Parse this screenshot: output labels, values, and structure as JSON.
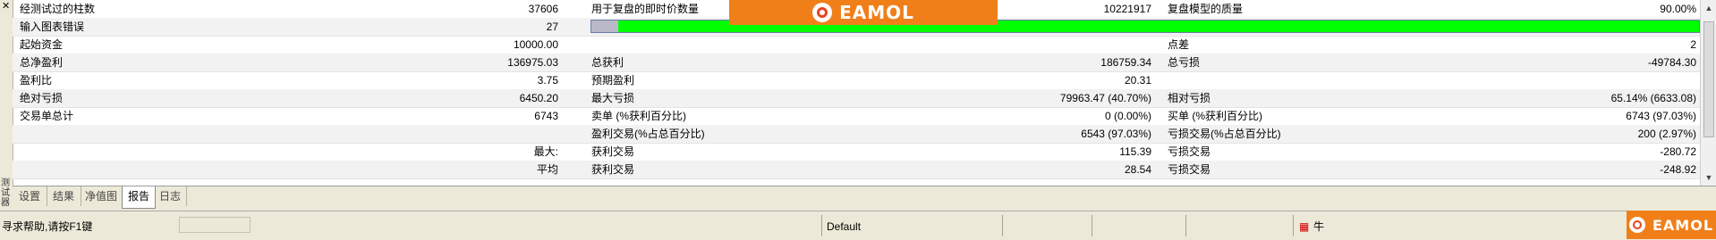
{
  "side": {
    "title": "测试器"
  },
  "rows": [
    {
      "l1": "经测试过的柱数",
      "v1": "37606",
      "l2": "用于复盘的即时价数量",
      "v2": "10221917",
      "l3": "复盘模型的质量",
      "v3": "90.00%"
    },
    {
      "l1": "输入图表错误",
      "v1": "27",
      "progress": {
        "value": 1.0
      }
    },
    {
      "l1": "起始资金",
      "v1": "10000.00",
      "l2": "",
      "v2": "",
      "l3": "点差",
      "v3": "2"
    },
    {
      "l1": "总净盈利",
      "v1": "136975.03",
      "l2": "总获利",
      "v2": "186759.34",
      "l3": "总亏损",
      "v3": "-49784.30"
    },
    {
      "l1": "盈利比",
      "v1": "3.75",
      "l2": "预期盈利",
      "v2": "20.31",
      "l3": "",
      "v3": ""
    },
    {
      "l1": "绝对亏损",
      "v1": "6450.20",
      "l2": "最大亏损",
      "v2": "79963.47 (40.70%)",
      "l3": "相对亏损",
      "v3": "65.14% (6633.08)"
    },
    {
      "l1": "交易单总计",
      "v1": "6743",
      "l2": "卖单 (%获利百分比)",
      "v2": "0 (0.00%)",
      "l3": "买单 (%获利百分比)",
      "v3": "6743 (97.03%)"
    },
    {
      "l1": "",
      "v1": "",
      "l2": "盈利交易(%占总百分比)",
      "v2": "6543 (97.03%)",
      "l3": "亏损交易(%占总百分比)",
      "v3": "200 (2.97%)"
    },
    {
      "l1": "",
      "v1": "最大:",
      "l2": "获利交易",
      "v2": "115.39",
      "l3": "亏损交易",
      "v3": "-280.72"
    },
    {
      "l1": "",
      "v1": "平均",
      "l2": "获利交易",
      "v2": "28.54",
      "l3": "亏损交易",
      "v3": "-248.92"
    }
  ],
  "tabs": [
    {
      "label": "设置",
      "active": false
    },
    {
      "label": "结果",
      "active": false
    },
    {
      "label": "净值图",
      "active": false
    },
    {
      "label": "报告",
      "active": true
    },
    {
      "label": "日志",
      "active": false
    }
  ],
  "status": {
    "help": "寻求帮助,请按F1键",
    "profile": "Default",
    "right_glyph": "牛"
  },
  "brand": {
    "logo_text": "EAMOL",
    "color": "#f07f1a"
  },
  "colors": {
    "progress_fill": "#00ff00",
    "progress_start": "#b9b9c9"
  }
}
